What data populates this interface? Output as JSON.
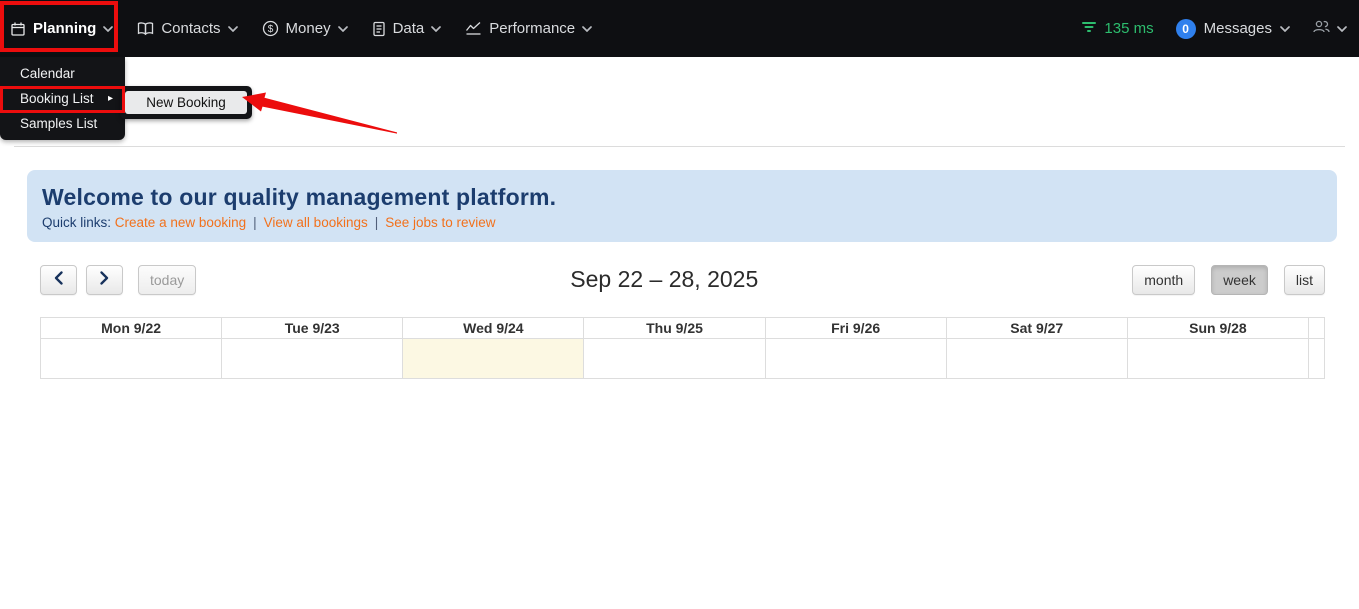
{
  "nav": {
    "items": [
      {
        "label": "Planning",
        "icon": "calendar-icon"
      },
      {
        "label": "Contacts",
        "icon": "book-icon"
      },
      {
        "label": "Money",
        "icon": "dollar-circle-icon"
      },
      {
        "label": "Data",
        "icon": "document-icon"
      },
      {
        "label": "Performance",
        "icon": "line-chart-icon"
      }
    ],
    "latency": "135 ms",
    "messages": {
      "count": "0",
      "label": "Messages"
    }
  },
  "dropdown": {
    "items": [
      "Calendar",
      "Booking List",
      "Samples List"
    ],
    "submenu": {
      "parent": "Booking List",
      "items": [
        "New Booking"
      ]
    }
  },
  "banner": {
    "title": "Welcome to our quality management platform.",
    "quick_links_label": "Quick links:",
    "links": [
      "Create a new booking",
      "View all bookings",
      "See jobs to review"
    ]
  },
  "calendar": {
    "title": "Sep 22 – 28, 2025",
    "today_label": "today",
    "views": [
      "month",
      "week",
      "list"
    ],
    "active_view": "week",
    "days": [
      "Mon 9/22",
      "Tue 9/23",
      "Wed 9/24",
      "Thu 9/25",
      "Fri 9/26",
      "Sat 9/27",
      "Sun 9/28"
    ],
    "today_index": 2
  },
  "colors": {
    "annotation_red": "#ec0d0d",
    "link_orange": "#f2711c",
    "banner_blue": "#d2e3f4",
    "heading_navy": "#1c3d6e",
    "latency_green": "#2dbd6e",
    "badge_blue": "#2f80ed",
    "today_highlight": "#fcf8e3",
    "nav_background": "#0e0f12"
  }
}
